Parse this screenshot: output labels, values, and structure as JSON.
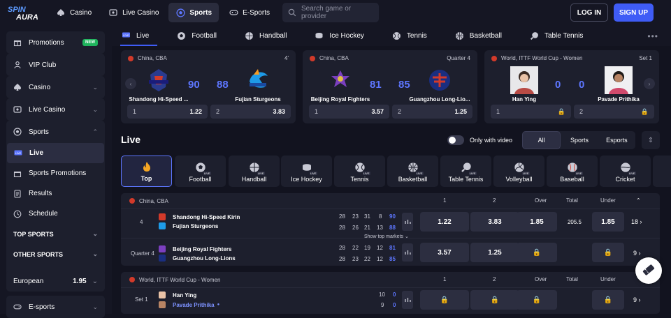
{
  "brand": {
    "logo_line1": "SPIN",
    "logo_line2": "AURA"
  },
  "topnav": {
    "items": [
      {
        "label": "Casino",
        "icon": "spade-icon"
      },
      {
        "label": "Live Casino",
        "icon": "live-casino-icon"
      },
      {
        "label": "Sports",
        "icon": "soccer-ball-icon"
      },
      {
        "label": "E-Sports",
        "icon": "gamepad-icon"
      }
    ],
    "search_placeholder": "Search game or provider",
    "login": "LOG IN",
    "signup": "SIGN UP"
  },
  "sidebar": {
    "promotions": "Promotions",
    "new_badge": "NEW",
    "vip": "VIP Club",
    "casino": "Casino",
    "live_casino": "Live Casino",
    "sports": "Sports",
    "sub": [
      "Live",
      "Sports Promotions",
      "Results",
      "Schedule"
    ],
    "top_sports": "TOP SPORTS",
    "other_sports": "OTHER SPORTS",
    "odds_format": "European",
    "odds_value": "1.95",
    "esports": "E-sports"
  },
  "sport_tabs": [
    "Live",
    "Football",
    "Handball",
    "Ice Hockey",
    "Tennis",
    "Basketball",
    "Table Tennis"
  ],
  "featured": [
    {
      "league": "China, CBA",
      "status": "4'",
      "home": "Shandong Hi-Speed ...",
      "away": "Fujian Sturgeons",
      "home_score": "90",
      "away_score": "88",
      "odd1_label": "1",
      "odd1": "1.22",
      "odd2_label": "2",
      "odd2": "3.83"
    },
    {
      "league": "China, CBA",
      "status": "Quarter 4",
      "home": "Beijing Royal Fighters",
      "away": "Guangzhou Long-Lio...",
      "home_score": "81",
      "away_score": "85",
      "odd1_label": "1",
      "odd1": "3.57",
      "odd2_label": "2",
      "odd2": "1.25"
    },
    {
      "league": "World, ITTF World Cup - Women",
      "status": "Set 1",
      "home": "Han Ying",
      "away": "Pavade Prithika",
      "home_score": "0",
      "away_score": "0",
      "odd1_label": "1",
      "odd2_label": "2"
    }
  ],
  "live": {
    "heading": "Live",
    "only_video": "Only with video",
    "filters": [
      "All",
      "Sports",
      "Esports"
    ]
  },
  "categories": [
    {
      "label": "Top",
      "icon": "flame-icon"
    },
    {
      "label": "Football",
      "icon": "soccer-ball-icon"
    },
    {
      "label": "Handball",
      "icon": "handball-icon"
    },
    {
      "label": "Ice Hockey",
      "icon": "hockey-puck-icon"
    },
    {
      "label": "Tennis",
      "icon": "tennis-ball-icon"
    },
    {
      "label": "Basketball",
      "icon": "basketball-icon"
    },
    {
      "label": "Table Tennis",
      "icon": "table-tennis-icon"
    },
    {
      "label": "Volleyball",
      "icon": "volleyball-icon"
    },
    {
      "label": "Baseball",
      "icon": "baseball-icon"
    },
    {
      "label": "Cricket",
      "icon": "cricket-icon"
    }
  ],
  "live_tag": "LIVE",
  "cba_table": {
    "league": "China, CBA",
    "cols": {
      "c1": "1",
      "c2": "2",
      "over": "Over",
      "total": "Total",
      "under": "Under"
    },
    "match1": {
      "period": "4",
      "home": "Shandong Hi-Speed Kirin",
      "away": "Fujian Sturgeons",
      "home_q": [
        "28",
        "23",
        "31",
        "8"
      ],
      "home_total": "90",
      "away_q": [
        "28",
        "26",
        "21",
        "13"
      ],
      "away_total": "88",
      "o1": "1.22",
      "o2": "3.83",
      "over": "1.85",
      "total": "205.5",
      "under": "1.85",
      "more": "18 ›"
    },
    "show_top": "Show top markets",
    "match2": {
      "period": "Quarter 4",
      "home": "Beijing Royal Fighters",
      "away": "Guangzhou Long-Lions",
      "home_q": [
        "28",
        "22",
        "19",
        "12"
      ],
      "home_total": "81",
      "away_q": [
        "28",
        "23",
        "22",
        "12"
      ],
      "away_total": "85",
      "o1": "3.57",
      "o2": "1.25",
      "more": "9 ›"
    }
  },
  "ittf_table": {
    "league": "World, ITTF World Cup - Women",
    "cols": {
      "c1": "1",
      "c2": "2",
      "over": "Over",
      "total": "Total",
      "under": "Under"
    },
    "match1": {
      "period": "Set 1",
      "home": "Han Ying",
      "away": "Pavade Prithika",
      "home_q": [
        "10"
      ],
      "home_total": "0",
      "away_q": [
        "9"
      ],
      "away_total": "0",
      "more": "9 ›"
    }
  },
  "colors": {
    "accent": "#3f5cf6",
    "score": "#5d76ff",
    "panel": "#1d1f2d",
    "bg": "#12131f"
  }
}
